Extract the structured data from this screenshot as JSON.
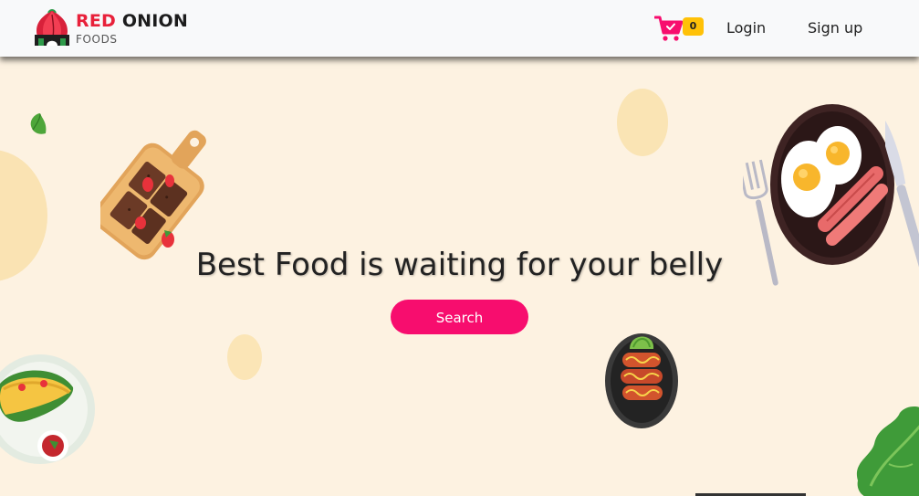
{
  "brand": {
    "title_highlight": "RED",
    "title_rest": "ONION",
    "subtitle": "FOODS",
    "logo_icon": "onion-logo-icon"
  },
  "nav": {
    "cart_icon": "shopping-cart-icon",
    "cart_count": "0",
    "login_label": "Login",
    "signup_label": "Sign up"
  },
  "hero": {
    "headline": "Best Food is waiting for your belly",
    "search_label": "Search"
  },
  "colors": {
    "brand_red": "#e8213a",
    "accent_pink": "#f70d6e",
    "badge_yellow": "#ffc107",
    "hero_background": "#fdf2e1",
    "navbar_background": "#f8f9fa"
  },
  "decorations": [
    "leaf-icon",
    "cutting-board-with-brownies-icon",
    "taco-plate-icon",
    "sausage-plate-icon",
    "eggs-and-sausage-plate-icon",
    "fork-icon",
    "knife-icon",
    "lettuce-icon"
  ]
}
